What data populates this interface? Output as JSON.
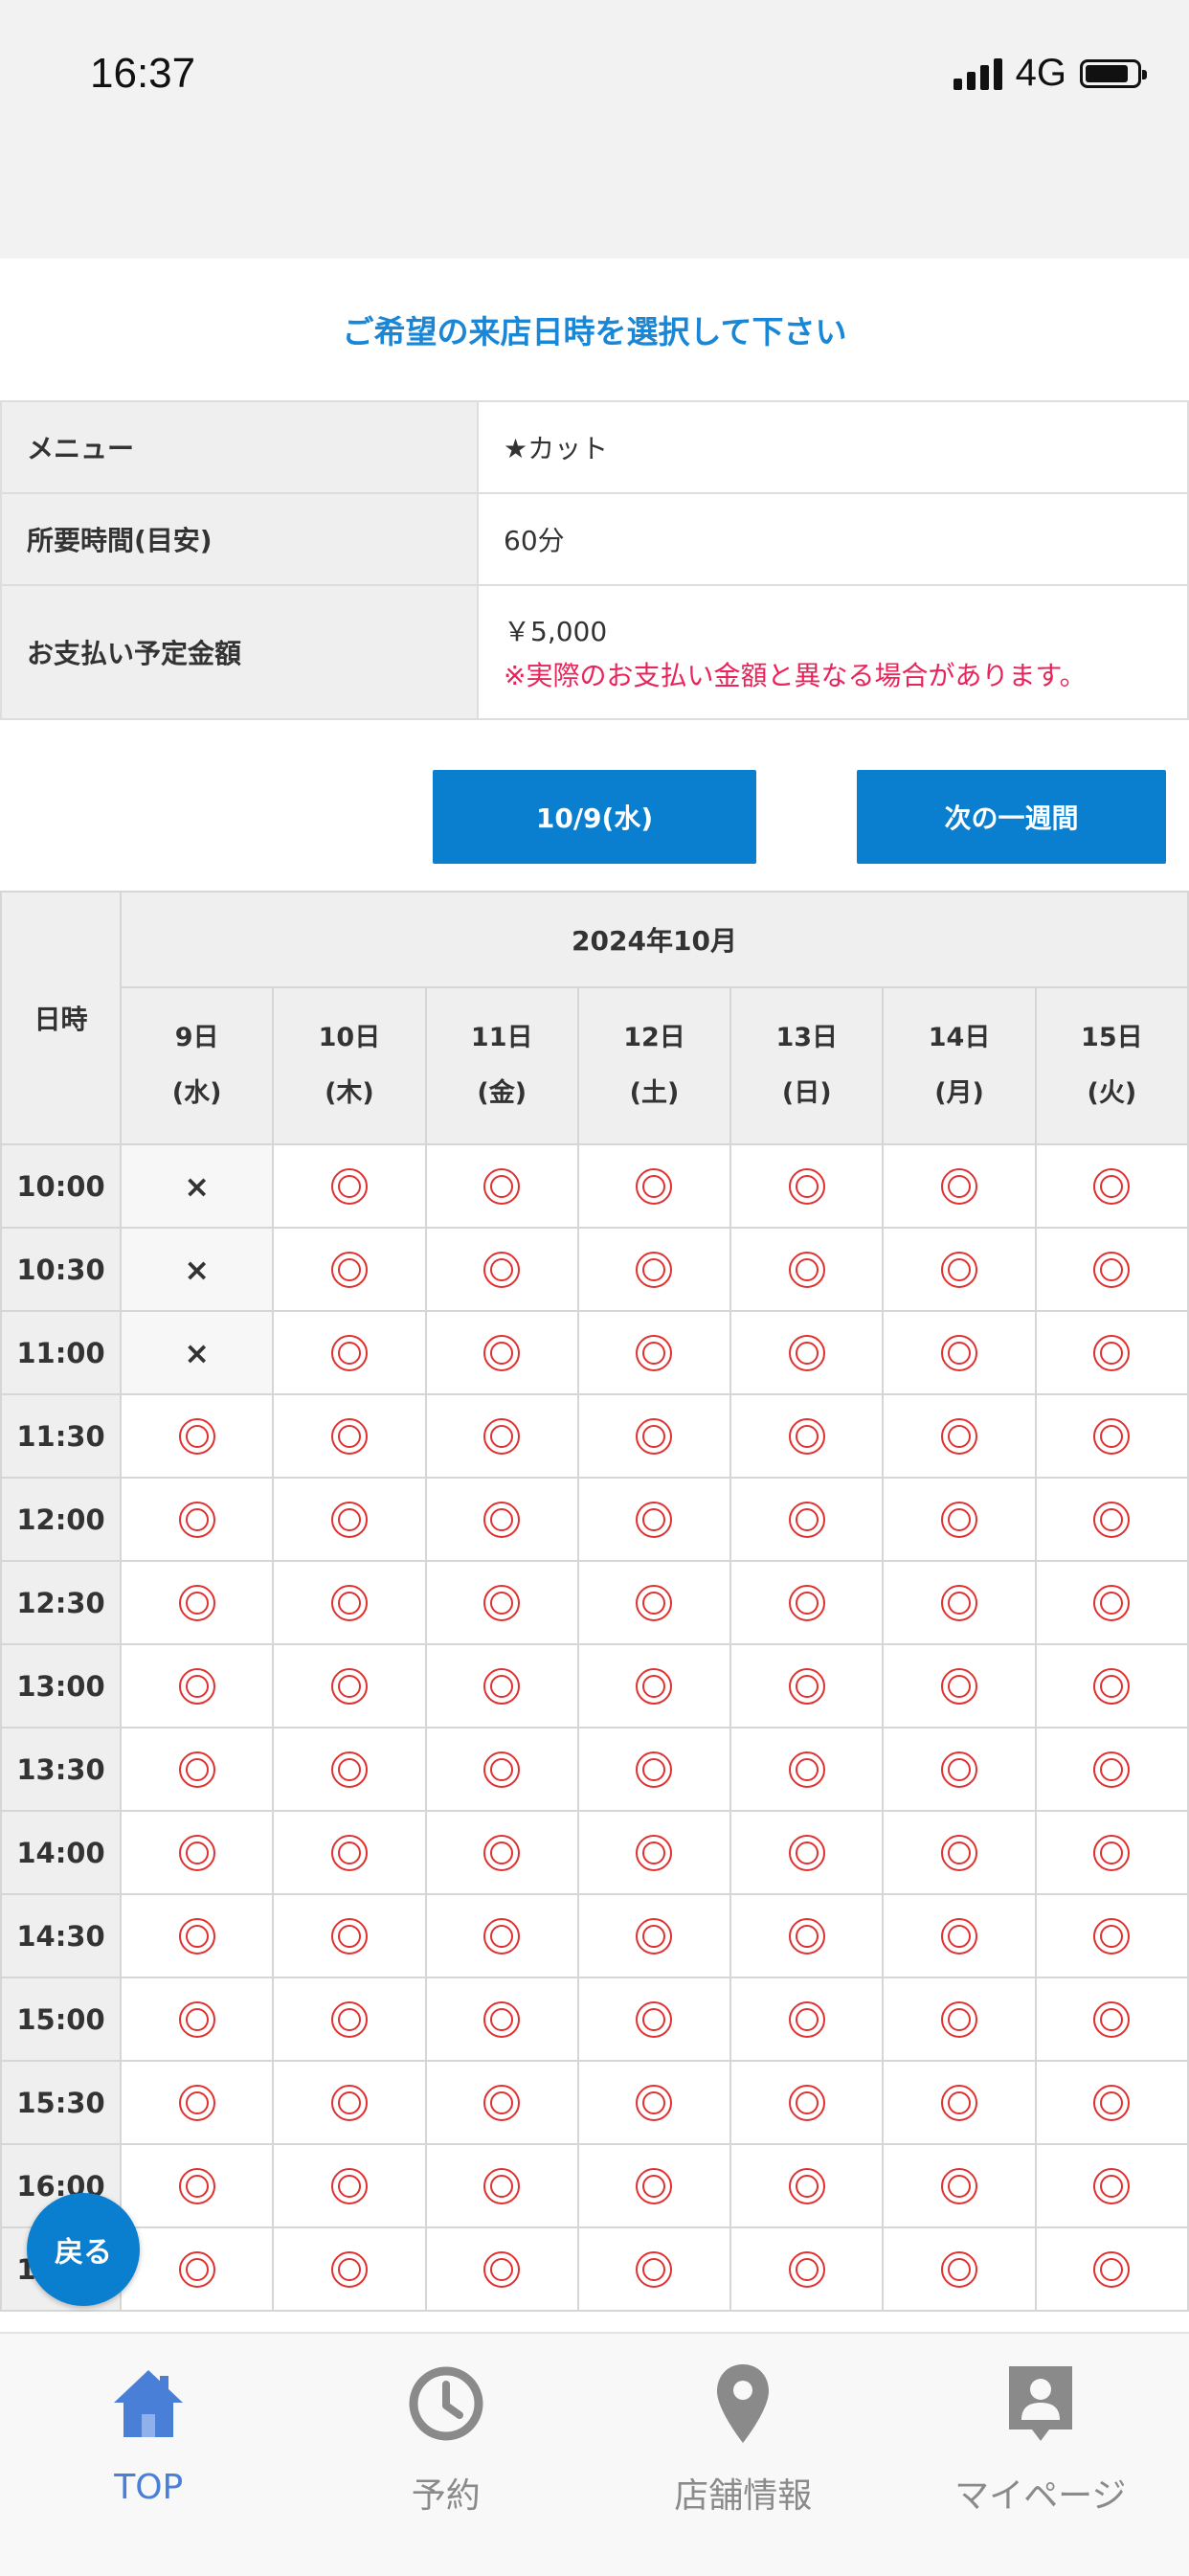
{
  "status": {
    "time": "16:37",
    "network": "4G"
  },
  "heading": "ご希望の来店日時を選択して下さい",
  "info": {
    "menu_label": "メニュー",
    "menu_value": "★カット",
    "duration_label": "所要時間(目安)",
    "duration_value": "60分",
    "price_label": "お支払い予定金額",
    "price_value": "￥5,000",
    "price_note": "※実際のお支払い金額と異なる場合があります。"
  },
  "buttons": {
    "date": "10/9(水)",
    "next_week": "次の一週間"
  },
  "schedule": {
    "corner_label": "日時",
    "month": "2024年10月",
    "days": [
      {
        "date": "9日",
        "weekday": "(水)"
      },
      {
        "date": "10日",
        "weekday": "(木)"
      },
      {
        "date": "11日",
        "weekday": "(金)"
      },
      {
        "date": "12日",
        "weekday": "(土)"
      },
      {
        "date": "13日",
        "weekday": "(日)"
      },
      {
        "date": "14日",
        "weekday": "(月)"
      },
      {
        "date": "15日",
        "weekday": "(火)"
      }
    ],
    "available_symbol": "◎",
    "full_symbol": "×",
    "rows": [
      {
        "time": "10:00",
        "slots": [
          "×",
          "◎",
          "◎",
          "◎",
          "◎",
          "◎",
          "◎"
        ]
      },
      {
        "time": "10:30",
        "slots": [
          "×",
          "◎",
          "◎",
          "◎",
          "◎",
          "◎",
          "◎"
        ]
      },
      {
        "time": "11:00",
        "slots": [
          "×",
          "◎",
          "◎",
          "◎",
          "◎",
          "◎",
          "◎"
        ]
      },
      {
        "time": "11:30",
        "slots": [
          "◎",
          "◎",
          "◎",
          "◎",
          "◎",
          "◎",
          "◎"
        ]
      },
      {
        "time": "12:00",
        "slots": [
          "◎",
          "◎",
          "◎",
          "◎",
          "◎",
          "◎",
          "◎"
        ]
      },
      {
        "time": "12:30",
        "slots": [
          "◎",
          "◎",
          "◎",
          "◎",
          "◎",
          "◎",
          "◎"
        ]
      },
      {
        "time": "13:00",
        "slots": [
          "◎",
          "◎",
          "◎",
          "◎",
          "◎",
          "◎",
          "◎"
        ]
      },
      {
        "time": "13:30",
        "slots": [
          "◎",
          "◎",
          "◎",
          "◎",
          "◎",
          "◎",
          "◎"
        ]
      },
      {
        "time": "14:00",
        "slots": [
          "◎",
          "◎",
          "◎",
          "◎",
          "◎",
          "◎",
          "◎"
        ]
      },
      {
        "time": "14:30",
        "slots": [
          "◎",
          "◎",
          "◎",
          "◎",
          "◎",
          "◎",
          "◎"
        ]
      },
      {
        "time": "15:00",
        "slots": [
          "◎",
          "◎",
          "◎",
          "◎",
          "◎",
          "◎",
          "◎"
        ]
      },
      {
        "time": "15:30",
        "slots": [
          "◎",
          "◎",
          "◎",
          "◎",
          "◎",
          "◎",
          "◎"
        ]
      },
      {
        "time": "16:00",
        "slots": [
          "◎",
          "◎",
          "◎",
          "◎",
          "◎",
          "◎",
          "◎"
        ]
      },
      {
        "time": "16:30",
        "slots": [
          "◎",
          "◎",
          "◎",
          "◎",
          "◎",
          "◎",
          "◎"
        ]
      }
    ]
  },
  "back_button": "戻る",
  "nav": [
    {
      "label": "TOP",
      "icon": "home-icon"
    },
    {
      "label": "予約",
      "icon": "clock-icon"
    },
    {
      "label": "店舗情報",
      "icon": "map-pin-icon"
    },
    {
      "label": "マイページ",
      "icon": "person-badge-icon"
    }
  ],
  "colors": {
    "accent": "#0a7fd0",
    "heading": "#1a86d6",
    "available": "#e03131",
    "note": "#e8245a",
    "nav_active": "#4a7fd8",
    "nav_inactive": "#8a8a8a"
  }
}
